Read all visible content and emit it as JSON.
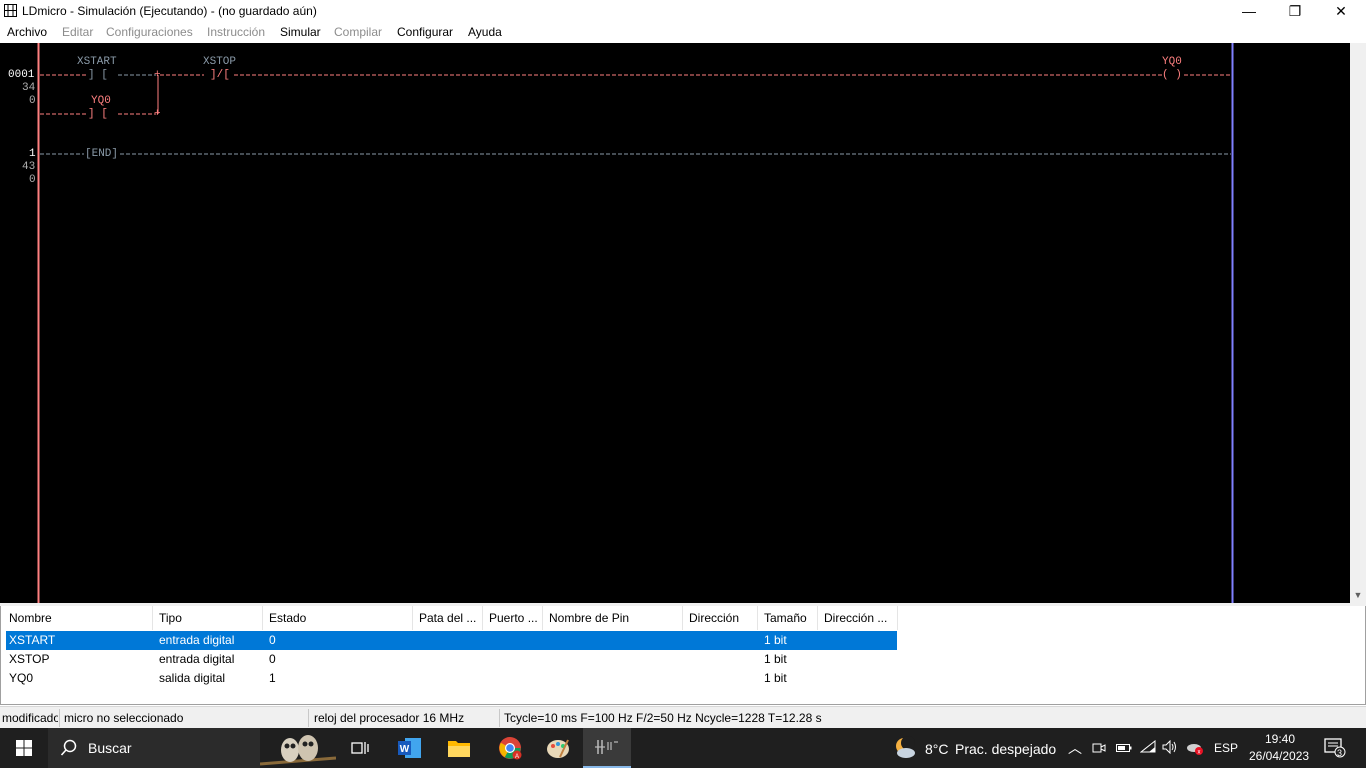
{
  "window": {
    "title": "LDmicro - Simulación (Ejecutando) - (no guardado aún)",
    "minimize_glyph": "—",
    "maximize_glyph": "❐",
    "close_glyph": "✕"
  },
  "menu": {
    "items": [
      {
        "label": "Archivo",
        "enabled": true
      },
      {
        "label": "Editar",
        "enabled": false
      },
      {
        "label": "Configuraciones",
        "enabled": false
      },
      {
        "label": "Instrucción",
        "enabled": false
      },
      {
        "label": "Simular",
        "enabled": true
      },
      {
        "label": "Compilar",
        "enabled": false
      },
      {
        "label": "Configurar",
        "enabled": true
      },
      {
        "label": "Ayuda",
        "enabled": true
      }
    ]
  },
  "ladder": {
    "colors": {
      "background": "#000000",
      "left_rail": "#ff8080",
      "right_rail": "#8080ff",
      "energized": "#ff8080",
      "de_energized": "#8a9aa8",
      "rung_number": "#ffffff",
      "rung_info": "#b0b0b0"
    },
    "rungs": [
      {
        "number": "0001",
        "info1": "34",
        "info2": "0",
        "contact1_name": "XSTART",
        "contact1_symbol": "] [",
        "contact2_name": "XSTOP",
        "contact2_symbol": "]/[",
        "parallel_name": "YQ0",
        "parallel_symbol": "] [",
        "coil_name": "YQ0",
        "coil_symbol": "( )"
      },
      {
        "number": "1",
        "info1": "43",
        "info2": "0",
        "end_label": "[END]"
      }
    ]
  },
  "io_list": {
    "columns": [
      "Nombre",
      "Tipo",
      "Estado",
      "Pata del ...",
      "Puerto ...",
      "Nombre de Pin",
      "Dirección",
      "Tamaño",
      "Dirección ..."
    ],
    "rows": [
      {
        "name": "XSTART",
        "type": "entrada digital",
        "state": "0",
        "size": "1 bit",
        "selected": true
      },
      {
        "name": "XSTOP",
        "type": "entrada digital",
        "state": "0",
        "size": "1 bit",
        "selected": false
      },
      {
        "name": "YQ0",
        "type": "salida digital",
        "state": "1",
        "size": "1 bit",
        "selected": false
      }
    ],
    "selection_color": "#0078d7"
  },
  "status_bar": {
    "modified": "modificado",
    "micro": "micro no seleccionado",
    "clock": "reloj del procesador 16 MHz",
    "cycle": "Tcycle=10 ms F=100 Hz F/2=50 Hz Ncycle=1228 T=12.28 s"
  },
  "taskbar": {
    "search_label": "Buscar",
    "weather_temp": "8°C",
    "weather_desc": "Prac. despejado",
    "language": "ESP",
    "time": "19:40",
    "date": "26/04/2023",
    "notification_count": "3"
  }
}
